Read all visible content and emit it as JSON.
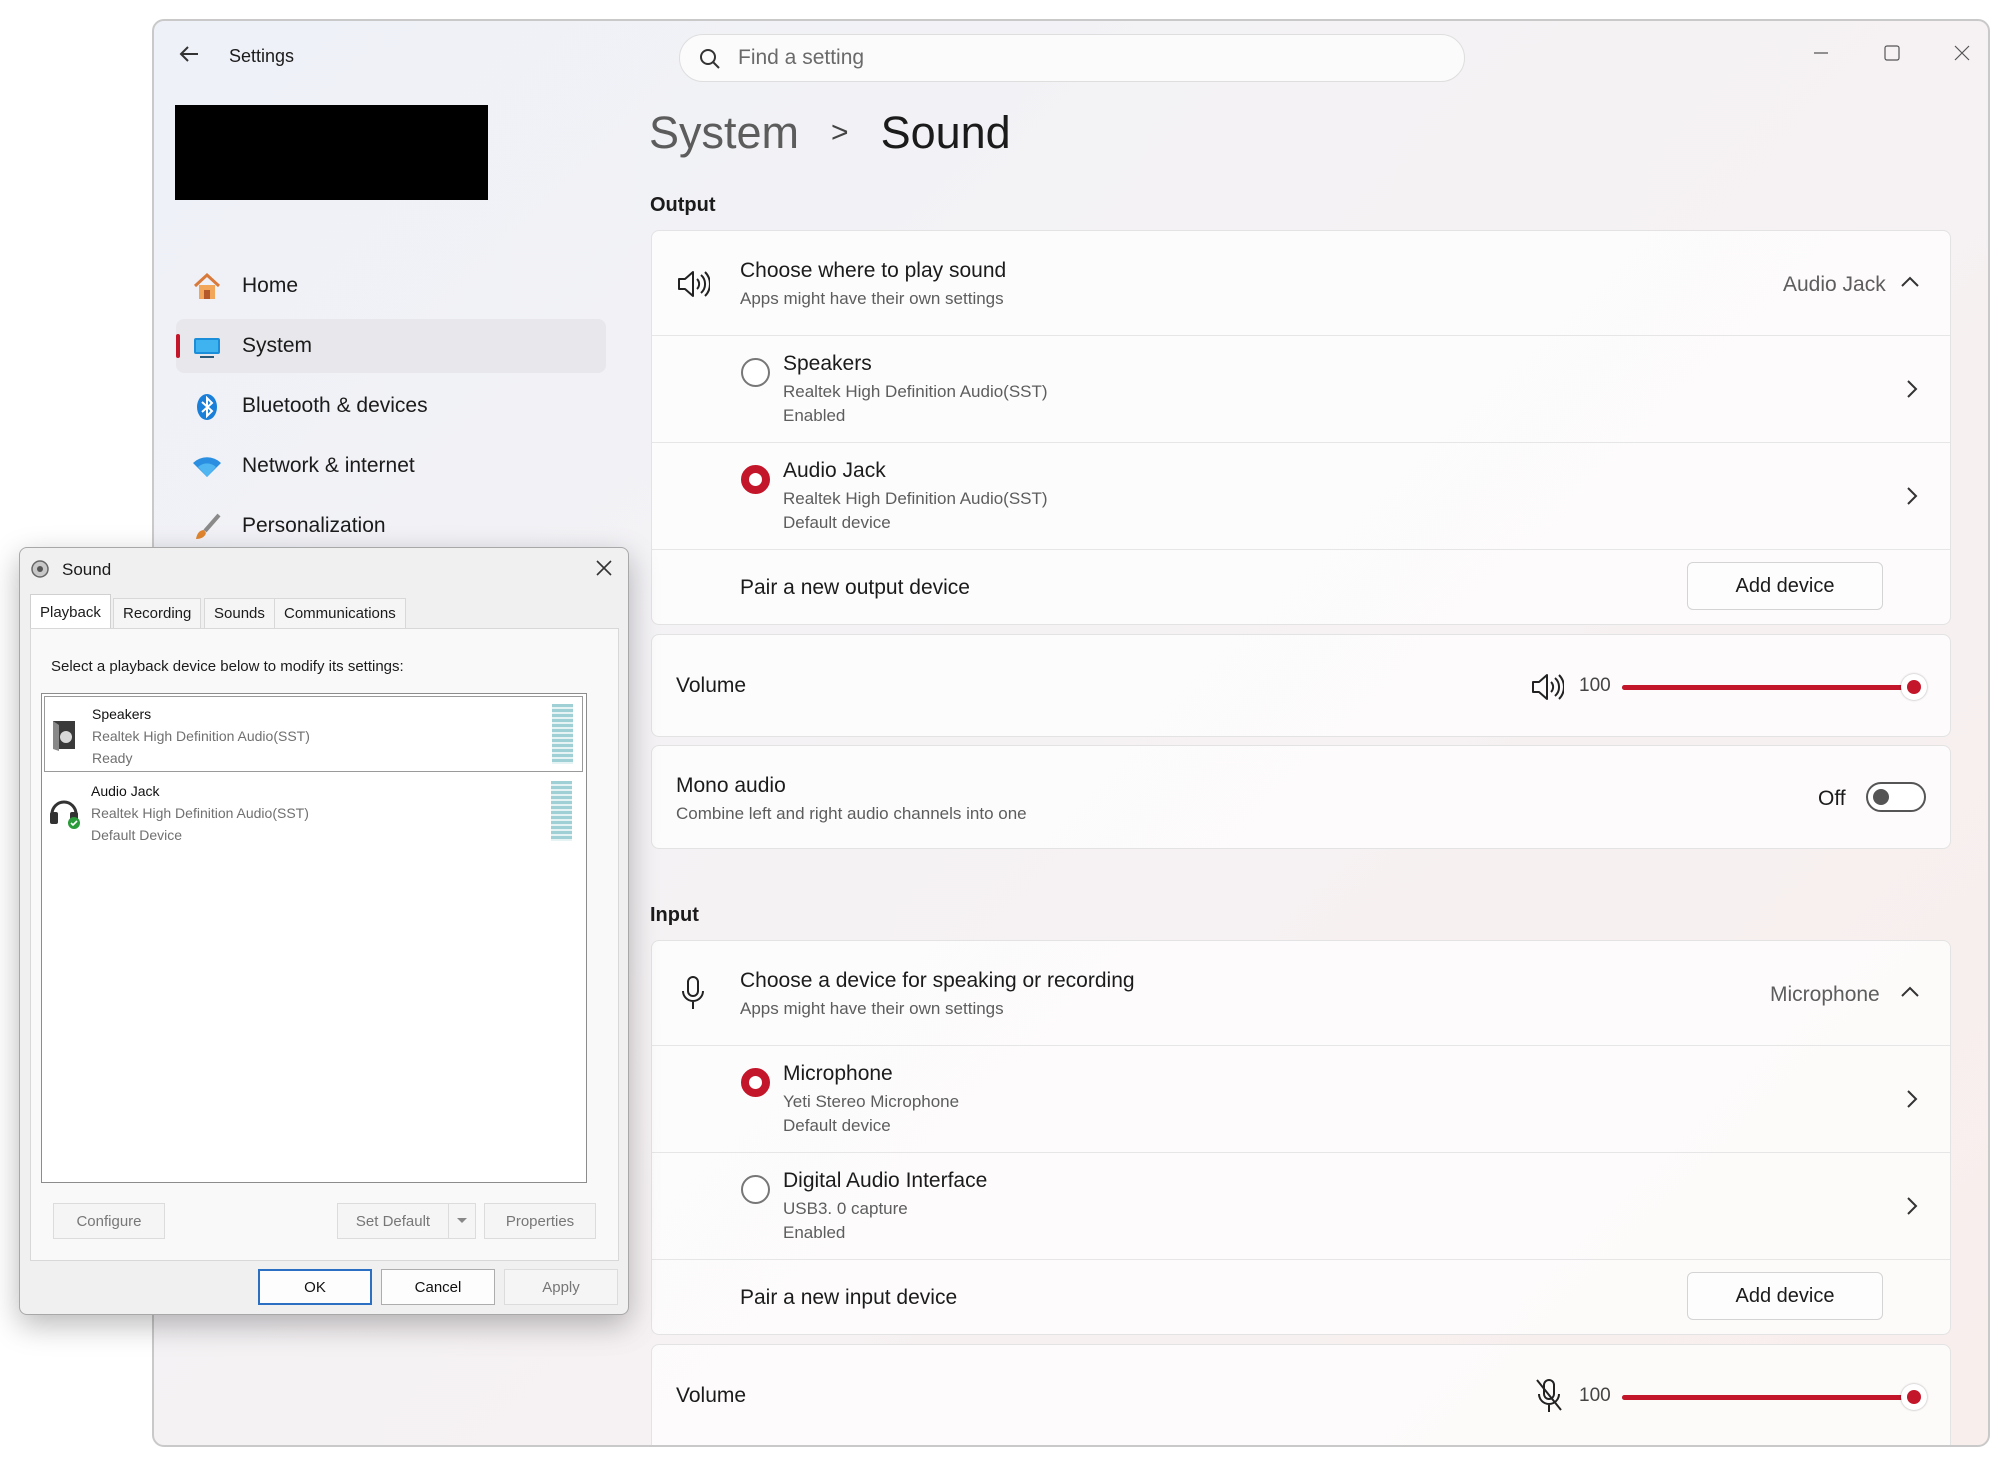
{
  "settings": {
    "title": "Settings",
    "search_placeholder": "Find a setting",
    "nav": [
      {
        "label": "Home",
        "icon": "home-icon"
      },
      {
        "label": "System",
        "icon": "system-icon",
        "active": true
      },
      {
        "label": "Bluetooth & devices",
        "icon": "bluetooth-icon"
      },
      {
        "label": "Network & internet",
        "icon": "wifi-icon"
      },
      {
        "label": "Personalization",
        "icon": "brush-icon"
      }
    ],
    "breadcrumb": {
      "parent": "System",
      "separator": ">",
      "current": "Sound"
    },
    "output": {
      "heading": "Output",
      "choose_title": "Choose where to play sound",
      "choose_sub": "Apps might have their own settings",
      "selected": "Audio Jack",
      "devices": [
        {
          "name": "Speakers",
          "line1": "Realtek High Definition Audio(SST)",
          "line2": "Enabled",
          "selected": false
        },
        {
          "name": "Audio Jack",
          "line1": "Realtek High Definition Audio(SST)",
          "line2": "Default device",
          "selected": true
        }
      ],
      "pair_label": "Pair a new output device",
      "add_button": "Add device",
      "volume_label": "Volume",
      "volume_value": "100",
      "volume_fraction": 1.0,
      "mono_title": "Mono audio",
      "mono_sub": "Combine left and right audio channels into one",
      "mono_state": "Off"
    },
    "input": {
      "heading": "Input",
      "choose_title": "Choose a device for speaking or recording",
      "choose_sub": "Apps might have their own settings",
      "selected": "Microphone",
      "devices": [
        {
          "name": "Microphone",
          "line1": "Yeti Stereo Microphone",
          "line2": "Default device",
          "selected": true
        },
        {
          "name": "Digital Audio Interface",
          "line1": "USB3. 0 capture",
          "line2": "Enabled",
          "selected": false
        }
      ],
      "pair_label": "Pair a new input device",
      "add_button": "Add device",
      "volume_label": "Volume",
      "volume_value": "100",
      "volume_fraction": 1.0
    },
    "accent_color": "#c4162a"
  },
  "dialog": {
    "title": "Sound",
    "tabs": [
      "Playback",
      "Recording",
      "Sounds",
      "Communications"
    ],
    "instruction": "Select a playback device below to modify its settings:",
    "devices": [
      {
        "name": "Speakers",
        "line1": "Realtek High Definition Audio(SST)",
        "line2": "Ready"
      },
      {
        "name": "Audio Jack",
        "line1": "Realtek High Definition Audio(SST)",
        "line2": "Default Device"
      }
    ],
    "buttons": {
      "configure": "Configure",
      "set_default": "Set Default",
      "properties": "Properties",
      "ok": "OK",
      "cancel": "Cancel",
      "apply": "Apply"
    }
  }
}
